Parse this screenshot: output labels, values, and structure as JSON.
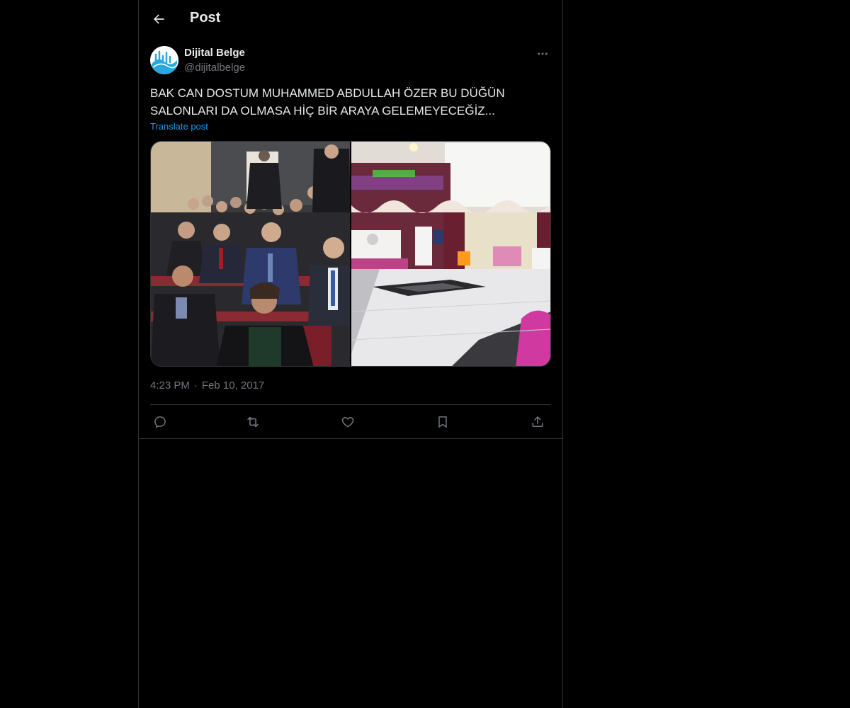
{
  "header": {
    "title": "Post",
    "back_icon": "arrow-left-icon"
  },
  "author": {
    "display_name": "Dijital Belge",
    "handle": "@dijitalbelge",
    "avatar_icon": "blue-wave-logo",
    "more_icon": "more-horizontal-icon"
  },
  "post": {
    "text": "BAK CAN DOSTUM MUHAMMED ABDULLAH ÖZER BU DÜĞÜN SALONLARI DA OLMASA HİÇ BİR ARAYA GELEMEYECEĞİZ...",
    "translate_label": "Translate post",
    "media": [
      "photo-audience-seated",
      "photo-wedding-hall"
    ],
    "time": "4:23 PM",
    "separator": "·",
    "date": "Feb 10, 2017"
  },
  "actions": [
    "reply-icon",
    "repost-icon",
    "like-icon",
    "bookmark-icon",
    "share-icon"
  ],
  "colors": {
    "background": "#000000",
    "text": "#e7e9ea",
    "muted": "#71767b",
    "link": "#1d9bf0",
    "border": "#2f3336"
  }
}
